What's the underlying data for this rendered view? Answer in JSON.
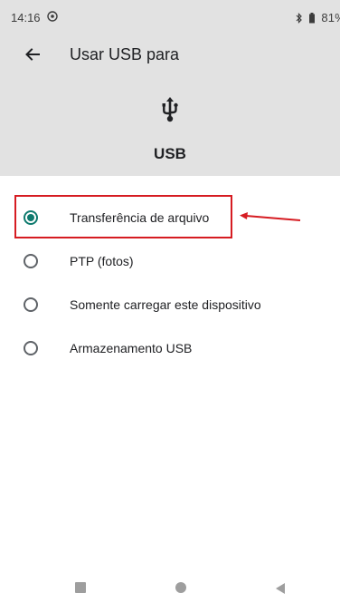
{
  "status_bar": {
    "time": "14:16",
    "battery": "81%"
  },
  "toolbar": {
    "title": "Usar USB para",
    "back_icon": "arrow-back-icon"
  },
  "header": {
    "icon": "usb-icon",
    "label": "USB"
  },
  "options": [
    {
      "label": "Transferência de arquivo",
      "selected": true
    },
    {
      "label": "PTP (fotos)",
      "selected": false
    },
    {
      "label": "Somente carregar este dispositivo",
      "selected": false
    },
    {
      "label": "Armazenamento USB",
      "selected": false
    }
  ],
  "annotation": {
    "color": "#d61c22"
  },
  "colors": {
    "accent": "#0e7a6e",
    "header_bg": "#e2e2e2"
  },
  "nav_bar": {
    "icons": [
      "recents-icon",
      "home-icon",
      "back-icon"
    ]
  }
}
